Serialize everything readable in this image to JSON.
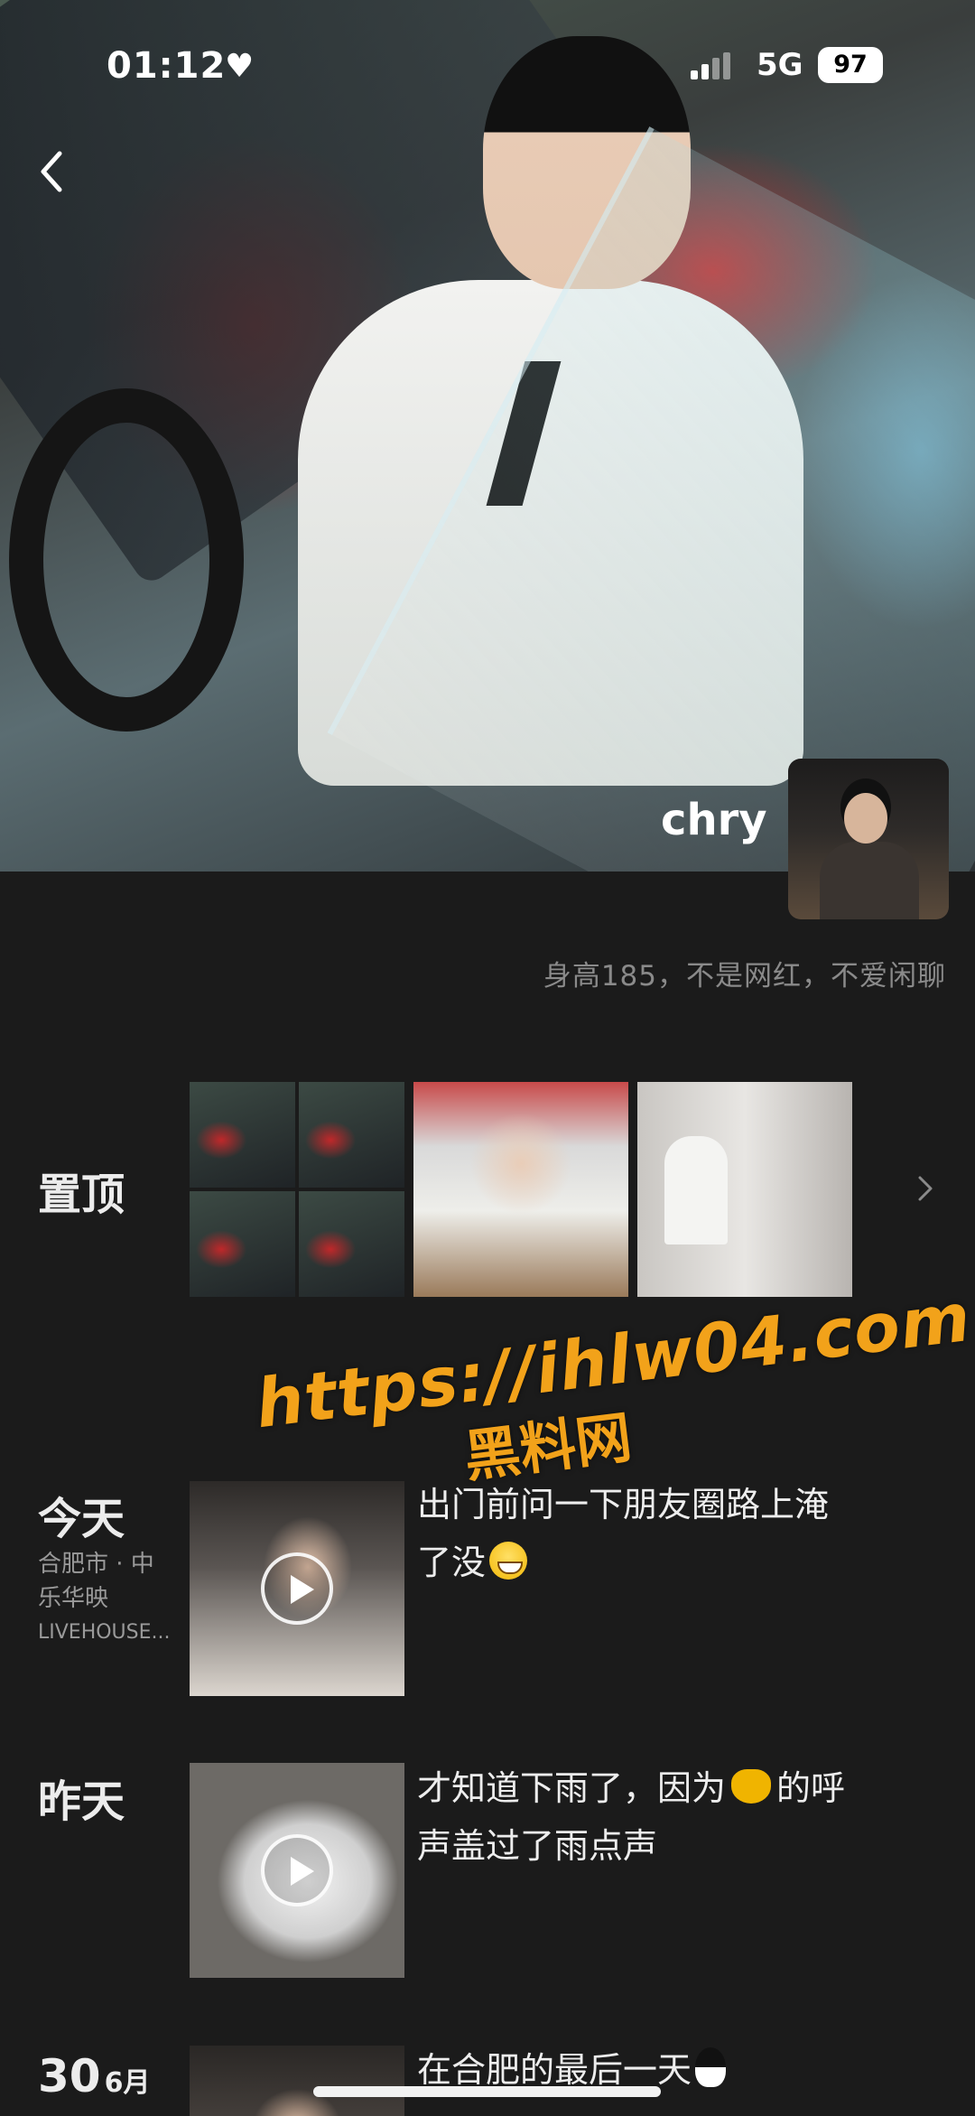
{
  "status_bar": {
    "time": "01:12",
    "network": "5G",
    "battery": "97"
  },
  "profile": {
    "username": "chry",
    "bio": "身高185，不是网红，不爱闲聊"
  },
  "pinned": {
    "label": "置顶"
  },
  "posts": [
    {
      "date_label": "今天",
      "location_line1": "合肥市 · 中",
      "location_line2": "乐华映",
      "location_line3": "LIVEHOUSE...",
      "text_line1": "出门前问一下朋友圈路上淹",
      "text_line2": "了没",
      "emoji": "grin-emoji",
      "media": "video"
    },
    {
      "date_label": "昨天",
      "text_line1_a": "才知道下雨了，因为",
      "text_line1_b": "的呼",
      "text_line2": "声盖过了雨点声",
      "emoji": "cat-emoji",
      "media": "video"
    },
    {
      "date_day": "30",
      "date_month": "6月",
      "text_line1": "在合肥的最后一天",
      "emoji": "penguin-emoji"
    }
  ],
  "watermark": {
    "url": "https://ihlw04.com",
    "site": "黑料网"
  },
  "colors": {
    "background": "#1b1b1b",
    "watermark": "#f2a21a",
    "text_primary": "#ececec",
    "text_secondary": "#8a8a8a"
  }
}
